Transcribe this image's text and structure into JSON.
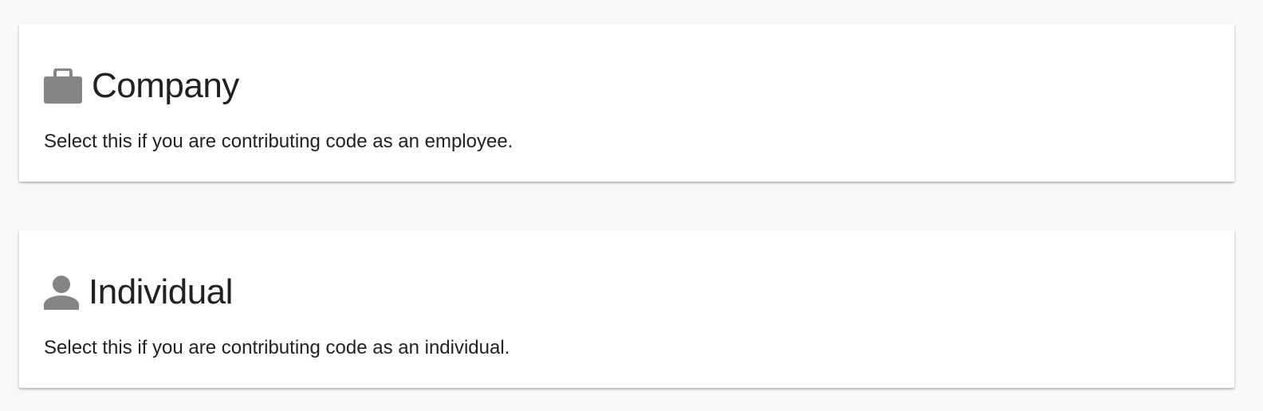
{
  "options": [
    {
      "id": "company",
      "title": "Company",
      "description": "Select this if you are contributing code as an employee.",
      "icon": "briefcase-icon"
    },
    {
      "id": "individual",
      "title": "Individual",
      "description": "Select this if you are contributing code as an individual.",
      "icon": "person-icon"
    }
  ],
  "colors": {
    "page_background": "#f8f8f8",
    "card_background": "#ffffff",
    "icon": "#858585",
    "text": "#212121"
  }
}
